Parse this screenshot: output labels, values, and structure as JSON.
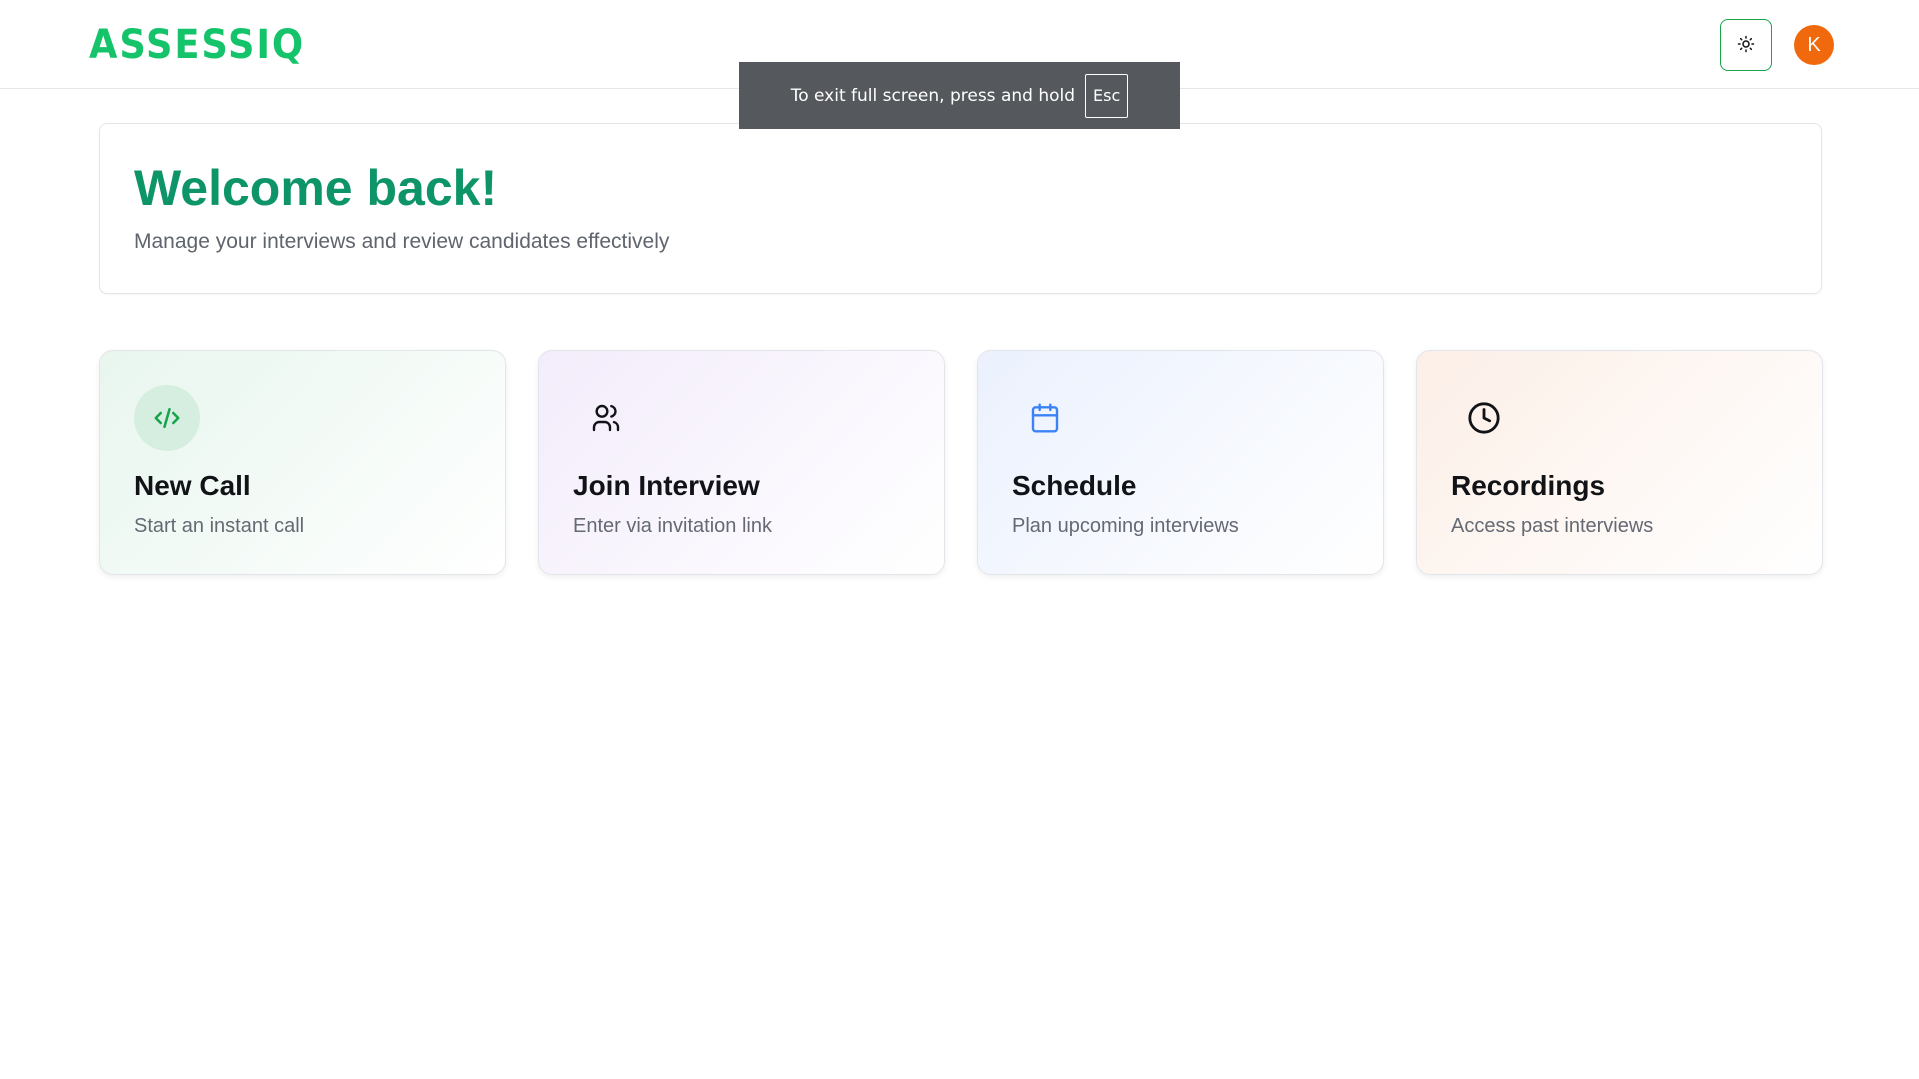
{
  "app": {
    "logo_text": "ASSESSIQ",
    "brand_color": "#15c46a"
  },
  "header": {
    "theme_toggle_icon": "sun-icon",
    "avatar_initial": "K",
    "avatar_color": "#f0690d"
  },
  "fullscreen_notice": {
    "message": "To exit full screen, press and hold",
    "key": "Esc"
  },
  "welcome": {
    "title": "Welcome back!",
    "subtitle": "Manage your interviews and review candidates effectively",
    "title_color": "#0d9468"
  },
  "actions": [
    {
      "title": "New Call",
      "subtitle": "Start an instant call",
      "icon": "code-icon",
      "icon_color": "#16a34a"
    },
    {
      "title": "Join Interview",
      "subtitle": "Enter via invitation link",
      "icon": "users-icon",
      "icon_color": "#111317"
    },
    {
      "title": "Schedule",
      "subtitle": "Plan upcoming interviews",
      "icon": "calendar-icon",
      "icon_color": "#3b82f6"
    },
    {
      "title": "Recordings",
      "subtitle": "Access past interviews",
      "icon": "clock-icon",
      "icon_color": "#111317"
    }
  ]
}
